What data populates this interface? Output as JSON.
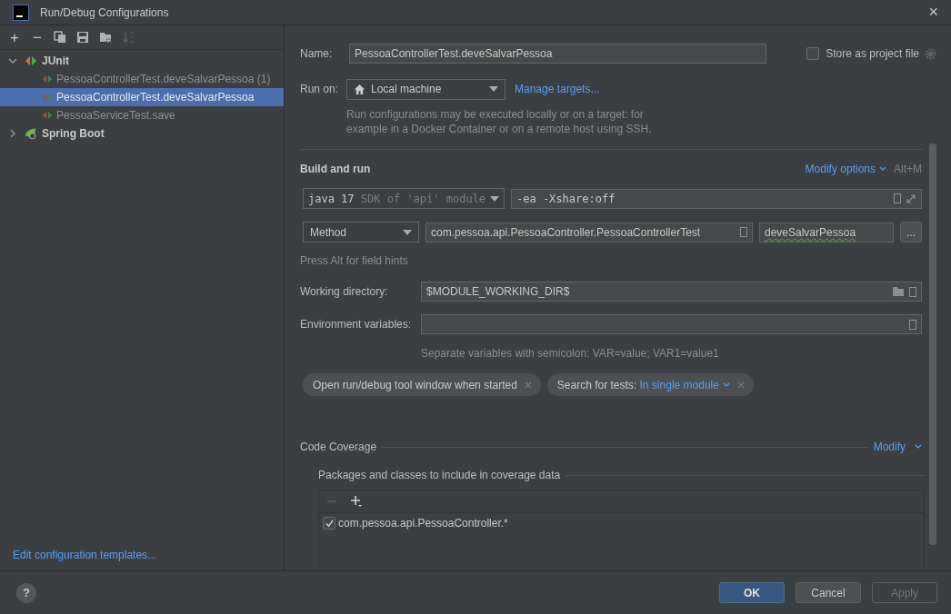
{
  "window": {
    "title": "Run/Debug Configurations",
    "close": "×"
  },
  "toolbar": {
    "add": "+",
    "remove": "−"
  },
  "tree": [
    {
      "label": "JUnit",
      "kind": "junit",
      "expanded": true,
      "selected": false,
      "children": [
        {
          "label": "PessoaControllerTest.deveSalvarPessoa (1)",
          "selected": false
        },
        {
          "label": "PessoaControllerTest.deveSalvarPessoa",
          "selected": true
        },
        {
          "label": "PessoaServiceTest.save",
          "selected": false
        }
      ]
    },
    {
      "label": "Spring Boot",
      "kind": "spring",
      "expanded": false,
      "selected": false
    }
  ],
  "edit_templates_link": "Edit configuration templates...",
  "form": {
    "name_label": "Name:",
    "name_value": "PessoaControllerTest.deveSalvarPessoa",
    "store_as_project_file": {
      "label": "Store as project file",
      "checked": false
    },
    "run_on_label": "Run on:",
    "run_on_value": "Local machine",
    "manage_targets": "Manage targets...",
    "run_on_hint": "Run configurations may be executed locally or on a target: for example in a Docker Container or on a remote host using SSH.",
    "build_and_run": "Build and run",
    "modify_options": "Modify options",
    "modify_shortcut": "Alt+M",
    "jdk_version": "java 17",
    "jdk_detail": "SDK of 'api' module",
    "vm_options": "-ea -Xshare:off",
    "test_kind": "Method",
    "test_class": "com.pessoa.api.PessoaController.PessoaControllerTest",
    "test_method": "deveSalvarPessoa",
    "browse": "...",
    "field_hint": "Press Alt for field hints",
    "working_dir_label": "Working directory:",
    "working_dir_value": "$MODULE_WORKING_DIR$",
    "env_label": "Environment variables:",
    "env_hint": "Separate variables with semicolon: VAR=value; VAR1=value1",
    "chips": [
      {
        "label": "Open run/debug tool window when started"
      },
      {
        "label": "Search for tests:",
        "value": "In single module"
      }
    ],
    "code_coverage": "Code Coverage",
    "modify": "Modify",
    "packages_title": "Packages and classes to include in coverage data",
    "packages": [
      {
        "label": "com.pessoa.api.PessoaController.*",
        "checked": true
      }
    ]
  },
  "help": "?",
  "buttons": [
    {
      "label": "OK",
      "kind": "primary",
      "disabled": false
    },
    {
      "label": "Cancel",
      "kind": "normal",
      "disabled": false
    },
    {
      "label": "Apply",
      "kind": "normal",
      "disabled": true
    }
  ]
}
